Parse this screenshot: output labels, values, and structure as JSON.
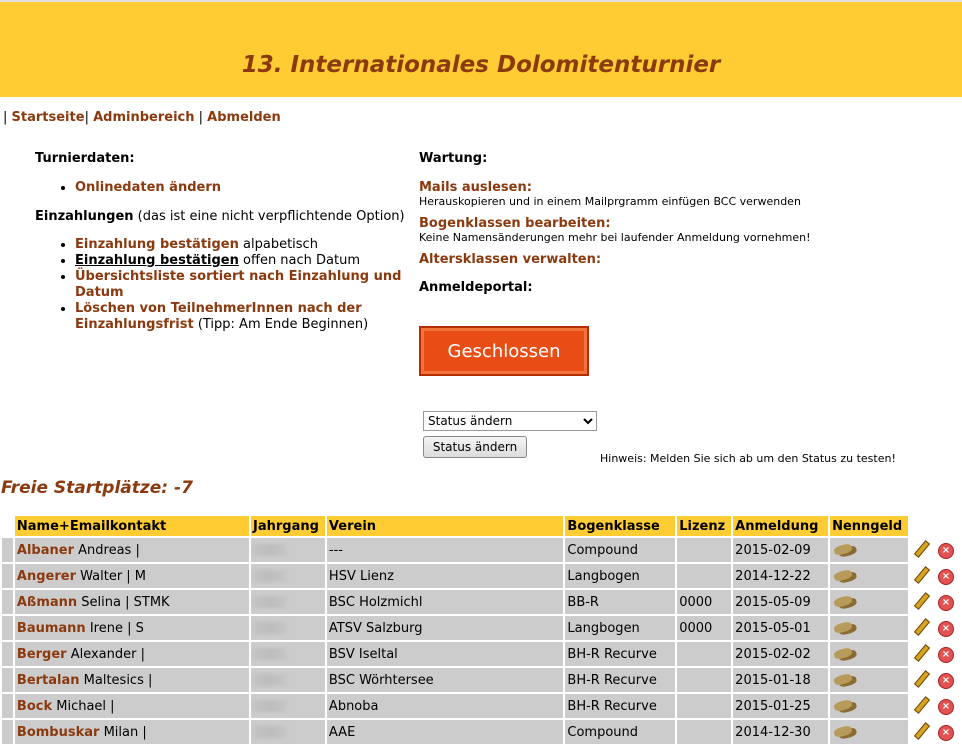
{
  "header": {
    "title": "13. Internationales Dolomitenturnier"
  },
  "nav": {
    "home": "Startseite",
    "admin": "Adminbereich",
    "logout": "Abmelden"
  },
  "left": {
    "turnierdaten_heading": "Turnierdaten:",
    "onlinedaten": "Onlinedaten ändern",
    "einzahlungen_heading": "Einzahlungen",
    "einzahlungen_note": "(das ist eine nicht verpflichtende Option)",
    "item1_link": "Einzahlung bestätigen",
    "item1_text": "alpabetisch",
    "item2_link": "Einzahlung bestätigen",
    "item2_text": "offen nach Datum",
    "item3_link": "Übersichtsliste sortiert nach Einzahlung und Datum",
    "item4_link": "Löschen von TeilnehmerInnen nach der Einzahlungsfrist",
    "item4_text": "(Tipp: Am Ende Beginnen)"
  },
  "right": {
    "wartung_heading": "Wartung:",
    "mails_link": "Mails auslesen:",
    "mails_note": "Herauskopieren und in einem Mailprgramm einfügen BCC verwenden",
    "bogen_link": "Bogenklassen bearbeiten:",
    "bogen_note": "Keine Namensänderungen mehr bei laufender Anmeldung vornehmen!",
    "alters_link": "Altersklassen verwalten:",
    "portal_heading": "Anmeldeportal:",
    "closed_label": "Geschlossen",
    "status_select_value": "Status ändern",
    "status_button": "Status ändern",
    "hint": "Hinweis: Melden Sie sich ab um den Status zu testen!"
  },
  "free_places": "Freie Startplätze: -7",
  "table": {
    "headers": [
      "Name+Emailkontakt",
      "Jahrgang",
      "Verein",
      "Bogenklasse",
      "Lizenz",
      "Anmeldung",
      "Nenngeld"
    ],
    "rows": [
      {
        "surname": "Albaner",
        "rest": "Andreas |",
        "verein": "---",
        "klasse": "Compound",
        "lizenz": "",
        "anmeldung": "2015-02-09"
      },
      {
        "surname": "Angerer",
        "rest": "Walter | M",
        "verein": "HSV Lienz",
        "klasse": "Langbogen",
        "lizenz": "",
        "anmeldung": "2014-12-22"
      },
      {
        "surname": "Aßmann",
        "rest": "Selina | STMK",
        "verein": "BSC Holzmichl",
        "klasse": "BB-R",
        "lizenz": "0000",
        "anmeldung": "2015-05-09"
      },
      {
        "surname": "Baumann",
        "rest": "Irene | S",
        "verein": "ATSV Salzburg",
        "klasse": "Langbogen",
        "lizenz": "0000",
        "anmeldung": "2015-05-01"
      },
      {
        "surname": "Berger",
        "rest": "Alexander |",
        "verein": "BSV Iseltal",
        "klasse": "BH-R Recurve",
        "lizenz": "",
        "anmeldung": "2015-02-02"
      },
      {
        "surname": "Bertalan",
        "rest": "Maltesics |",
        "verein": "BSC Wörhtersee",
        "klasse": "BH-R Recurve",
        "lizenz": "",
        "anmeldung": "2015-01-18"
      },
      {
        "surname": "Bock",
        "rest": "Michael |",
        "verein": "Abnoba",
        "klasse": "BH-R Recurve",
        "lizenz": "",
        "anmeldung": "2015-01-25"
      },
      {
        "surname": "Bombuskar",
        "rest": "Milan |",
        "verein": "AAE",
        "klasse": "Compound",
        "lizenz": "",
        "anmeldung": "2014-12-30"
      }
    ]
  },
  "icons": {
    "payment": "money-icon",
    "edit": "pencil-icon",
    "delete": "delete-icon"
  }
}
